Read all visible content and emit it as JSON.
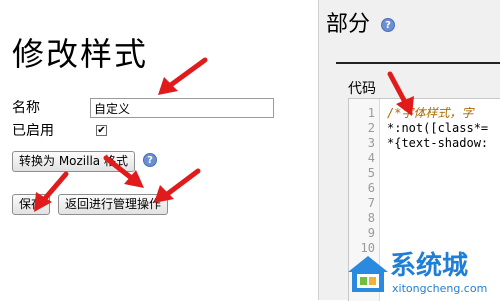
{
  "form": {
    "title": "修改样式",
    "name_label": "名称",
    "name_value": "自定义",
    "enabled_label": "已启用",
    "enabled_checked": true,
    "convert_button": "转换为 Mozilla 格式",
    "save_button": "保存",
    "back_button": "返回进行管理操作"
  },
  "section": {
    "title": "部分",
    "code_label": "代码"
  },
  "code": {
    "line_numbers": [
      "1",
      "2",
      "3",
      "4",
      "5",
      "6",
      "7",
      "8",
      "9",
      "10"
    ],
    "lines": [
      "/*字体样式，字",
      "*:not([class*=",
      "*{text-shadow:"
    ]
  },
  "watermark": {
    "brand": "系统城",
    "domain": "xitongcheng.com"
  },
  "colors": {
    "arrow": "#e11b1b",
    "watermark_blue": "#1f7fd6"
  },
  "icons": {
    "help": "help-icon",
    "checkmark": "checkmark-icon",
    "house": "house-logo-icon"
  }
}
